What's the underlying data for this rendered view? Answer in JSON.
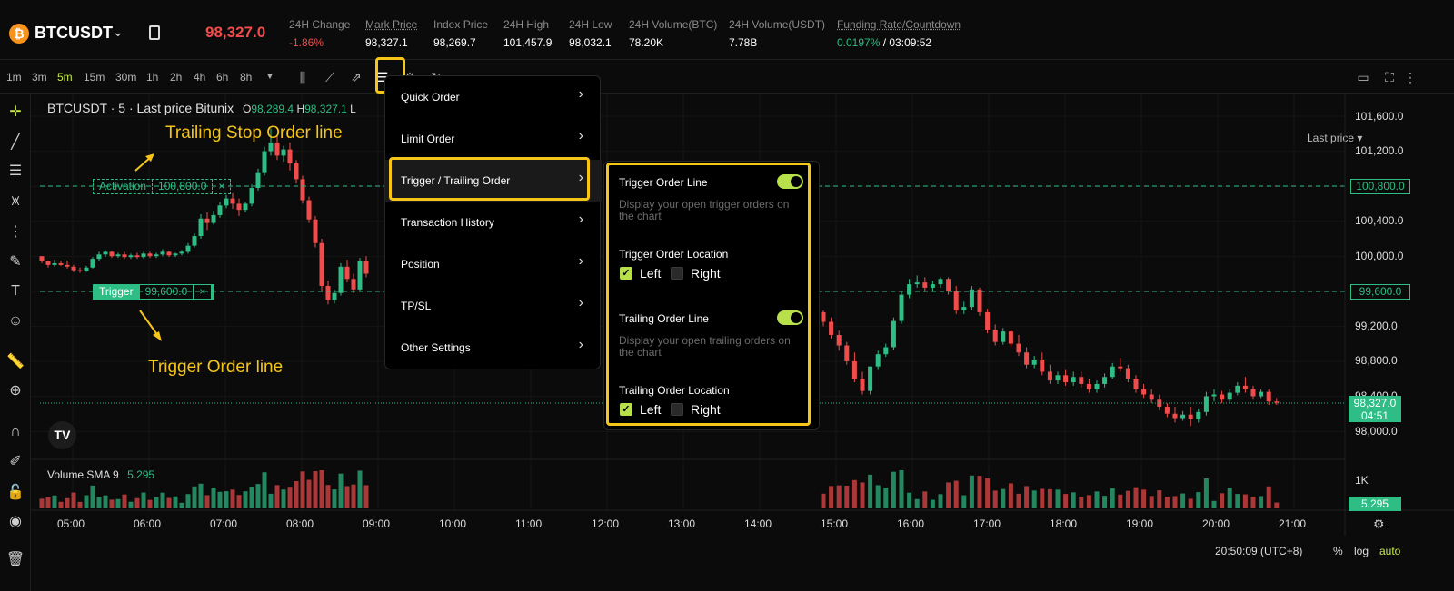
{
  "header": {
    "coin_glyph": "₿",
    "symbol": "BTCUSDT",
    "last_price": "98,327.0",
    "stats": [
      {
        "label": "24H Change",
        "value": "-1.86%",
        "color": "red"
      },
      {
        "label": "Mark Price",
        "value": "98,327.1",
        "color": "white"
      },
      {
        "label": "Index Price",
        "value": "98,269.7",
        "color": "white"
      },
      {
        "label": "24H High",
        "value": "101,457.9",
        "color": "white"
      },
      {
        "label": "24H Low",
        "value": "98,032.1",
        "color": "white"
      },
      {
        "label": "24H Volume(BTC)",
        "value": "78.20K",
        "color": "white"
      },
      {
        "label": "24H Volume(USDT)",
        "value": "7.78B",
        "color": "white"
      },
      {
        "label": "Funding Rate/Countdown",
        "value_rate": "0.0197%",
        "value_countdown": "/ 03:09:52"
      }
    ]
  },
  "toolbar": {
    "timeframes": [
      "1m",
      "3m",
      "5m",
      "15m",
      "30m",
      "1h",
      "2h",
      "4h",
      "6h",
      "8h"
    ],
    "active_timeframe": "5m",
    "price_source": "Last price"
  },
  "chart": {
    "title": "BTCUSDT · 5 · Last price Bitunix",
    "ohlc": {
      "o_label": "O",
      "o": "98,289.4",
      "h_label": "H",
      "h": "98,327.1",
      "l_label": "L"
    },
    "price_axis": [
      "101,600.0",
      "101,200.0",
      "100,800.0",
      "100,400.0",
      "100,000.0",
      "99,600.0",
      "99,200.0",
      "98,800.0",
      "98,400.0",
      "98,000.0"
    ],
    "time_axis": [
      "05:00",
      "06:00",
      "07:00",
      "08:00",
      "09:00",
      "10:00",
      "11:00",
      "12:00",
      "13:00",
      "14:00",
      "15:00",
      "16:00",
      "17:00",
      "18:00",
      "19:00",
      "20:00",
      "21:00"
    ],
    "current_price": "98,327.0",
    "current_countdown": "04:51",
    "activation_tag": {
      "label": "Activation",
      "price": "100,800.0",
      "close": "×"
    },
    "trigger_tag": {
      "label": "Trigger",
      "price": "99,600.0",
      "close": "×"
    },
    "activation_axis": "100,800.0",
    "trigger_axis": "99,600.0",
    "annotations": {
      "trailing": "Trailing Stop Order line",
      "trigger": "Trigger Order line"
    },
    "volume": {
      "label": "Volume SMA 9",
      "value": "5.295",
      "axis_top": "1K",
      "badge": "5.295"
    },
    "tv_logo": "TV",
    "clock": "20:50:09 (UTC+8)",
    "scale_buttons": [
      "%",
      "log",
      "auto"
    ]
  },
  "menu": {
    "items": [
      "Quick Order",
      "Limit Order",
      "Trigger / Trailing Order",
      "Transaction History",
      "Position",
      "TP/SL",
      "Other Settings"
    ],
    "selected": "Trigger / Trailing Order"
  },
  "submenu": {
    "trigger_line_title": "Trigger Order Line",
    "trigger_line_desc": "Display your open trigger orders on the chart",
    "trigger_location_title": "Trigger Order Location",
    "trailing_line_title": "Trailing Order Line",
    "trailing_line_desc": "Display your open trailing orders on the chart",
    "trailing_location_title": "Trailing Order Location",
    "left": "Left",
    "right": "Right",
    "trigger_line_on": true,
    "trailing_line_on": true,
    "trigger_location": "Left",
    "trailing_location": "Left"
  },
  "colors": {
    "up": "#2ebd85",
    "down": "#f04c4c",
    "accent": "#c6e84a",
    "highlight": "#f5c518"
  },
  "candles": [
    [
      100000,
      99980,
      99940,
      99920
    ],
    [
      99940,
      99950,
      99900,
      99870
    ],
    [
      99900,
      99960,
      99920,
      99880
    ],
    [
      99920,
      99950,
      99900,
      99890
    ],
    [
      99900,
      99950,
      99880,
      99860
    ],
    [
      99880,
      99900,
      99840,
      99820
    ],
    [
      99840,
      99870,
      99830,
      99810
    ],
    [
      99830,
      99890,
      99870,
      99820
    ],
    [
      99870,
      99990,
      99970,
      99860
    ],
    [
      99970,
      100050,
      100020,
      99950
    ],
    [
      100020,
      100070,
      100050,
      99990
    ],
    [
      100050,
      100060,
      100000,
      99980
    ],
    [
      100000,
      100040,
      100020,
      99980
    ],
    [
      100020,
      100050,
      99990,
      99970
    ],
    [
      99990,
      100030,
      100010,
      99970
    ],
    [
      100010,
      100040,
      99990,
      99970
    ],
    [
      99990,
      100050,
      100030,
      99970
    ],
    [
      100030,
      100050,
      100000,
      99980
    ],
    [
      100000,
      100040,
      100020,
      99980
    ],
    [
      100020,
      100080,
      100050,
      100000
    ],
    [
      100050,
      100060,
      100010,
      99990
    ],
    [
      100010,
      100040,
      100030,
      99990
    ],
    [
      100030,
      100070,
      100050,
      100010
    ],
    [
      100050,
      100150,
      100120,
      100030
    ],
    [
      100120,
      100260,
      100230,
      100100
    ],
    [
      100230,
      100480,
      100430,
      100200
    ],
    [
      100430,
      100500,
      100380,
      100300
    ],
    [
      100380,
      100520,
      100470,
      100360
    ],
    [
      100470,
      100620,
      100580,
      100440
    ],
    [
      100580,
      100700,
      100660,
      100550
    ],
    [
      100660,
      100720,
      100600,
      100540
    ],
    [
      100600,
      100660,
      100530,
      100460
    ],
    [
      100530,
      100620,
      100600,
      100500
    ],
    [
      100600,
      100820,
      100780,
      100570
    ],
    [
      100780,
      101000,
      100950,
      100750
    ],
    [
      100950,
      101250,
      101200,
      100920
    ],
    [
      101200,
      101460,
      101300,
      101150
    ],
    [
      101300,
      101380,
      101150,
      101100
    ],
    [
      101150,
      101260,
      101220,
      101080
    ],
    [
      101220,
      101300,
      101060,
      100980
    ],
    [
      101060,
      101100,
      100880,
      100830
    ],
    [
      100880,
      100920,
      100640,
      100600
    ],
    [
      100640,
      100680,
      100420,
      100380
    ],
    [
      100420,
      100460,
      100150,
      100100
    ],
    [
      100150,
      100200,
      99660,
      99600
    ],
    [
      99660,
      99720,
      99500,
      99450
    ],
    [
      99500,
      99620,
      99580,
      99460
    ],
    [
      99580,
      99920,
      99880,
      99550
    ],
    [
      99880,
      99960,
      99740,
      99700
    ],
    [
      99740,
      99800,
      99620,
      99580
    ],
    [
      99620,
      99980,
      99940,
      99600
    ],
    [
      99940,
      100000,
      99800,
      99760
    ]
  ],
  "candles_right": [
    [
      99360,
      99380,
      99250,
      99200
    ],
    [
      99250,
      99300,
      99100,
      99060
    ],
    [
      99100,
      99150,
      98980,
      98920
    ],
    [
      98980,
      99020,
      98800,
      98760
    ],
    [
      98800,
      98900,
      98600,
      98560
    ],
    [
      98600,
      98680,
      98460,
      98420
    ],
    [
      98460,
      98560,
      98740,
      98420
    ],
    [
      98740,
      98920,
      98880,
      98700
    ],
    [
      98880,
      99000,
      98960,
      98850
    ],
    [
      98960,
      99300,
      99260,
      98930
    ],
    [
      99260,
      99600,
      99560,
      99230
    ],
    [
      99560,
      99740,
      99680,
      99520
    ],
    [
      99680,
      99780,
      99700,
      99640
    ],
    [
      99700,
      99760,
      99640,
      99600
    ],
    [
      99640,
      99720,
      99680,
      99600
    ],
    [
      99680,
      99760,
      99740,
      99640
    ],
    [
      99740,
      99760,
      99600,
      99560
    ],
    [
      99600,
      99660,
      99380,
      99340
    ],
    [
      99380,
      99480,
      99420,
      99340
    ],
    [
      99420,
      99660,
      99620,
      99380
    ],
    [
      99620,
      99640,
      99360,
      99320
    ],
    [
      99360,
      99400,
      99160,
      99120
    ],
    [
      99160,
      99220,
      99020,
      98980
    ],
    [
      99020,
      99180,
      99140,
      98990
    ],
    [
      99140,
      99160,
      99000,
      98960
    ],
    [
      99000,
      99100,
      98900,
      98860
    ],
    [
      98900,
      98960,
      98760,
      98720
    ],
    [
      98760,
      98860,
      98820,
      98720
    ],
    [
      98820,
      98900,
      98680,
      98640
    ],
    [
      98680,
      98760,
      98580,
      98540
    ],
    [
      98580,
      98680,
      98640,
      98540
    ],
    [
      98640,
      98700,
      98560,
      98520
    ],
    [
      98560,
      98680,
      98620,
      98520
    ],
    [
      98620,
      98680,
      98540,
      98500
    ],
    [
      98540,
      98600,
      98480,
      98440
    ],
    [
      98480,
      98580,
      98540,
      98440
    ],
    [
      98540,
      98660,
      98620,
      98500
    ],
    [
      98620,
      98780,
      98740,
      98600
    ],
    [
      98740,
      98840,
      98720,
      98680
    ],
    [
      98720,
      98760,
      98600,
      98560
    ],
    [
      98600,
      98640,
      98480,
      98440
    ],
    [
      98480,
      98540,
      98420,
      98380
    ],
    [
      98420,
      98480,
      98360,
      98320
    ],
    [
      98360,
      98420,
      98280,
      98240
    ],
    [
      98280,
      98320,
      98200,
      98160
    ],
    [
      98200,
      98280,
      98150,
      98100
    ],
    [
      98150,
      98230,
      98190,
      98120
    ],
    [
      98190,
      98280,
      98140,
      98060
    ],
    [
      98140,
      98260,
      98220,
      98100
    ],
    [
      98220,
      98450,
      98400,
      98180
    ],
    [
      98400,
      98480,
      98420,
      98340
    ],
    [
      98420,
      98460,
      98360,
      98320
    ],
    [
      98360,
      98480,
      98440,
      98330
    ],
    [
      98440,
      98560,
      98520,
      98410
    ],
    [
      98520,
      98620,
      98480,
      98440
    ],
    [
      98480,
      98520,
      98400,
      98360
    ],
    [
      98400,
      98480,
      98450,
      98380
    ],
    [
      98450,
      98480,
      98340,
      98300
    ],
    [
      98340,
      98380,
      98327,
      98300
    ]
  ]
}
